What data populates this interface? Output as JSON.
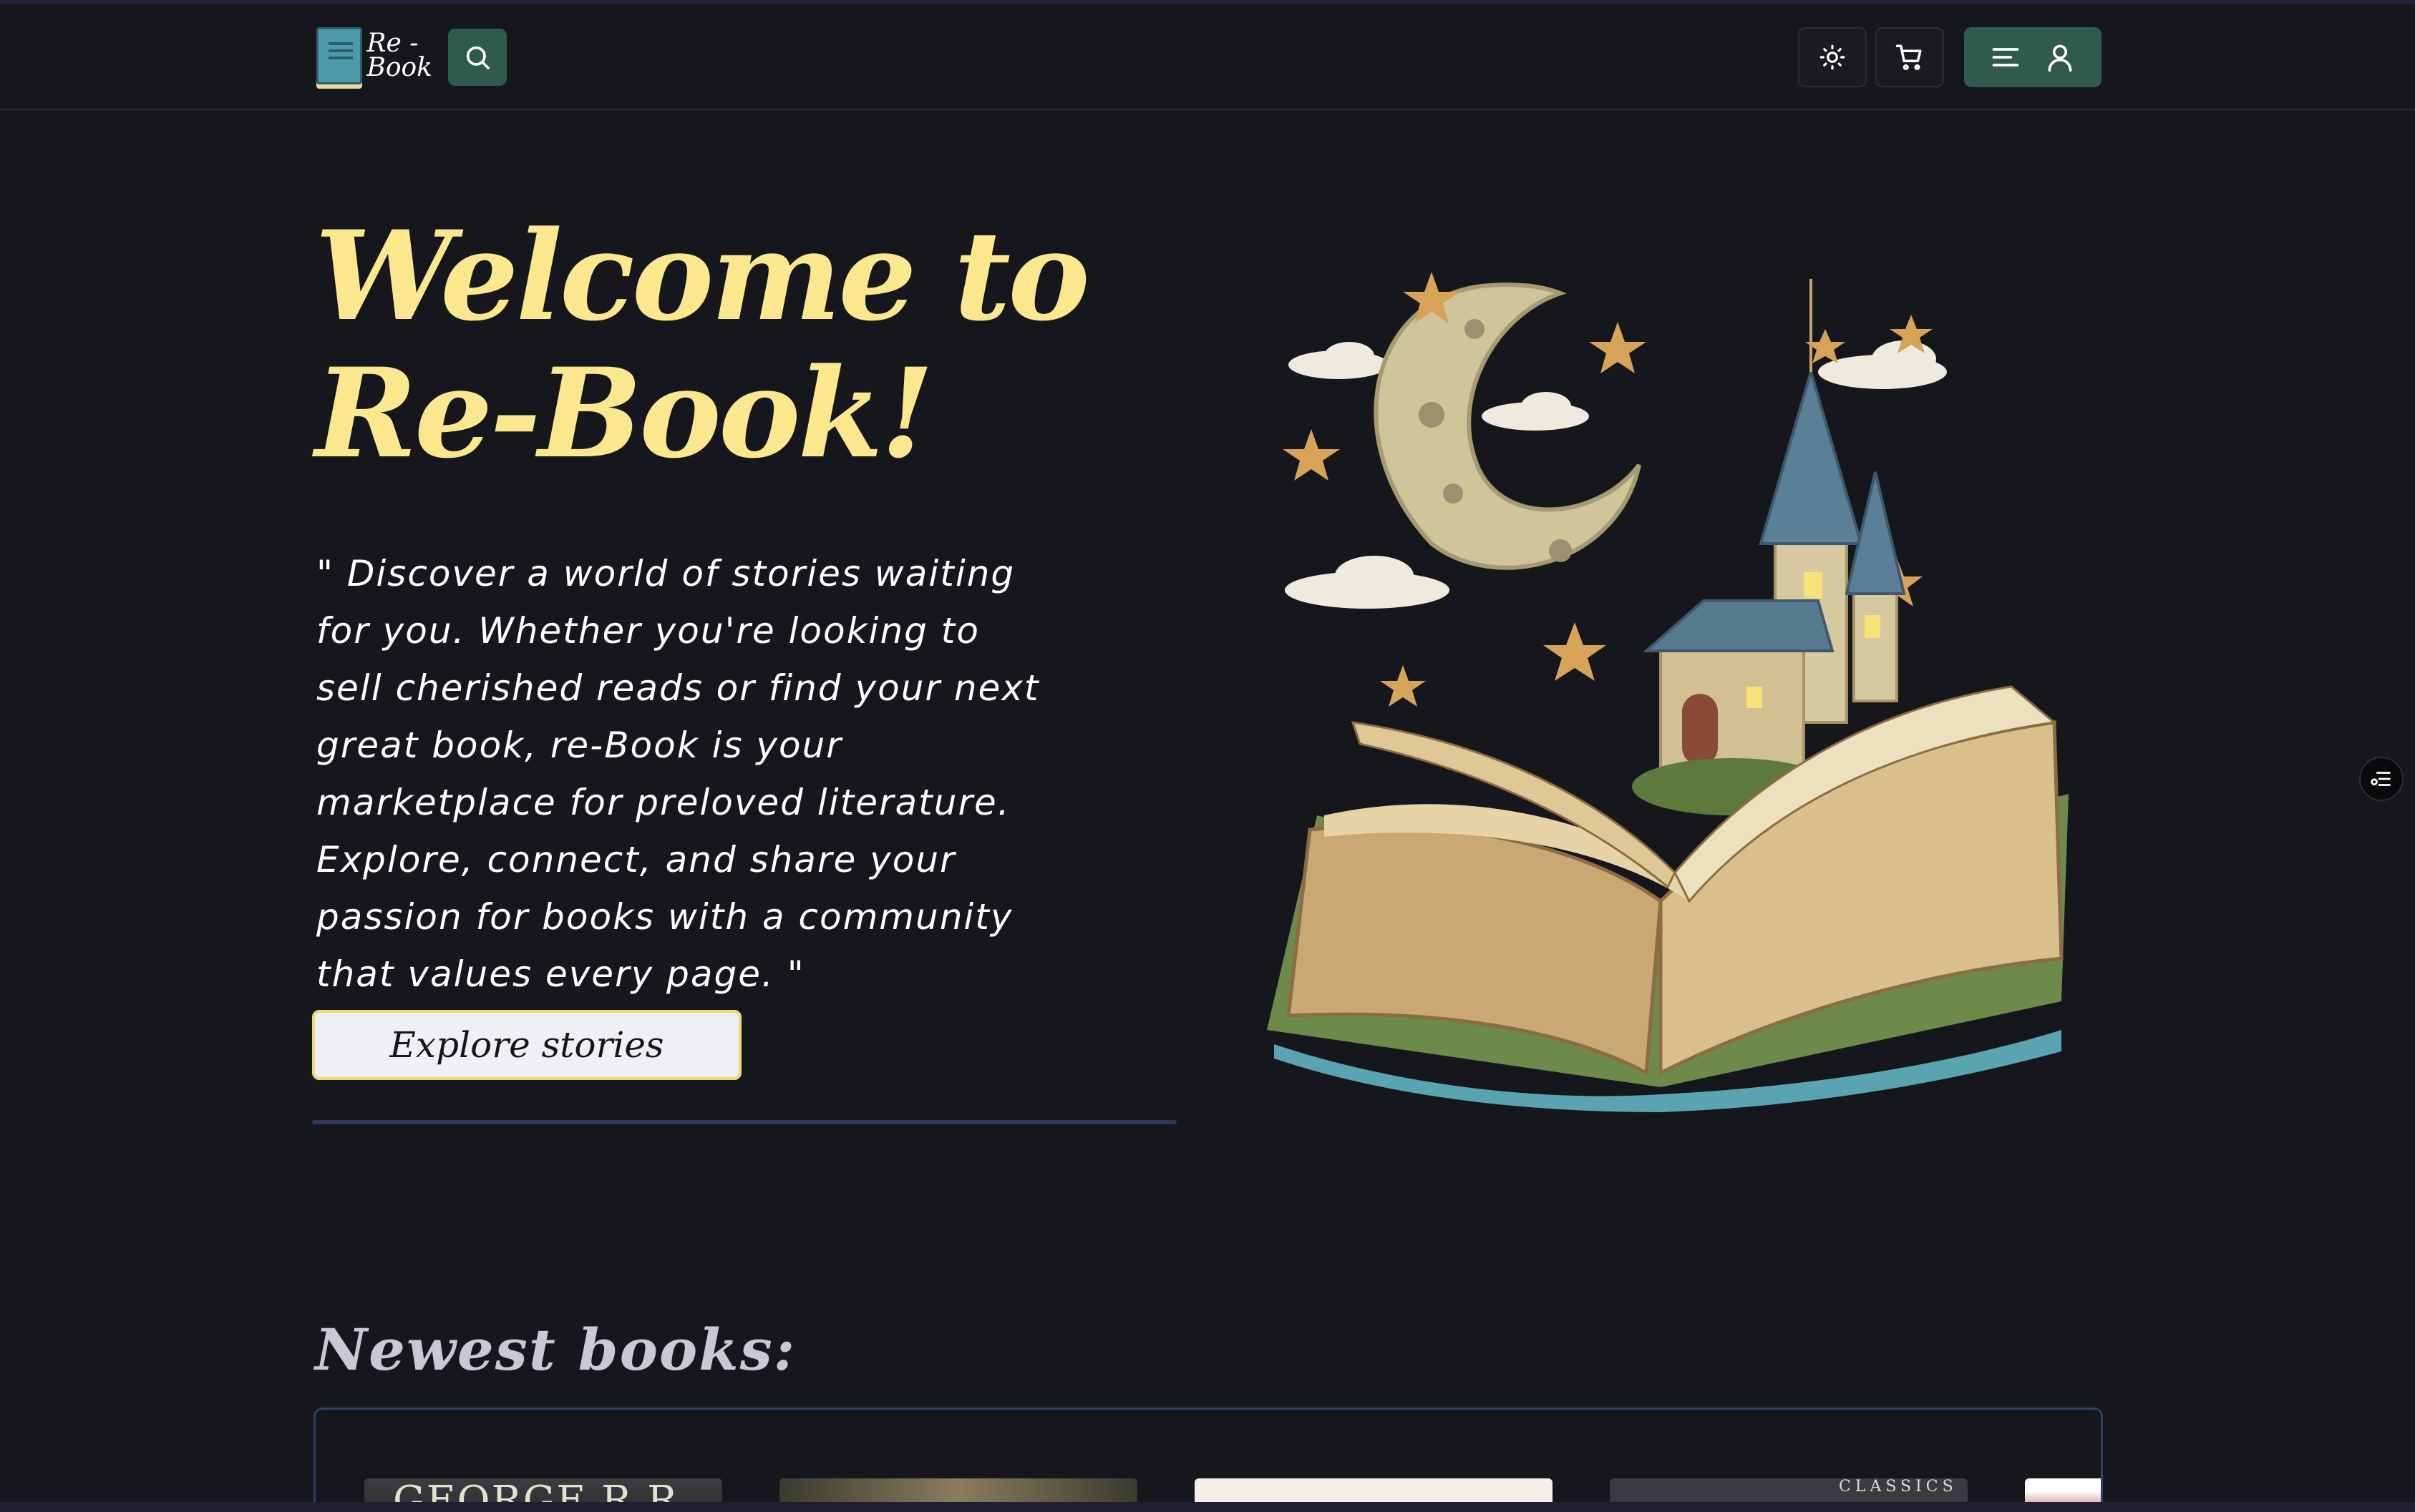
{
  "header": {
    "logo_line1": "Re -",
    "logo_line2": "Book"
  },
  "hero": {
    "title_line1": "Welcome to",
    "title_line2": "Re-Book!",
    "quote": "\" Discover a world of stories waiting for you. Whether you're looking to sell cherished reads or find your next great book, re-Book is your marketplace for preloved literature. Explore, connect, and share your passion for books with a community that values every page. \"",
    "cta_label": "Explore stories"
  },
  "newest": {
    "title": "Newest books:",
    "book1_visible_text": "GEORGE R.R",
    "book4_visible_text": "CLASSICS"
  },
  "colors": {
    "background": "#16171d",
    "accent_green": "#2f5a4c",
    "title_yellow": "#fbe78e",
    "divider_blue": "#2c3a58"
  },
  "icons": {
    "search": "search-icon",
    "theme": "sun-icon",
    "cart": "cart-icon",
    "menu": "hamburger-icon",
    "user": "user-icon",
    "side": "filter-list-icon"
  }
}
